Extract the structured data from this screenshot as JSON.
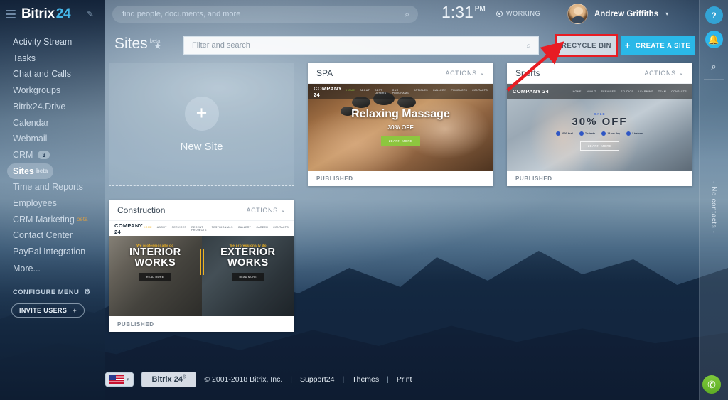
{
  "brand": {
    "name": "Bitrix",
    "number": "24",
    "hamburger_icon": "hamburger-icon",
    "edit_icon": "pencil-icon"
  },
  "topbar": {
    "search_placeholder": "find people, documents, and more",
    "search_icon": "search-icon",
    "time": "1:31",
    "ampm": "PM",
    "status": "WORKING",
    "status_icon": "record-dot-icon",
    "user_name": "Andrew Griffiths",
    "user_caret": "▾"
  },
  "sidebar": {
    "items": [
      {
        "label": "Activity Stream"
      },
      {
        "label": "Tasks"
      },
      {
        "label": "Chat and Calls"
      },
      {
        "label": "Workgroups"
      },
      {
        "label": "Bitrix24.Drive"
      },
      {
        "label": "Calendar"
      },
      {
        "label": "Webmail"
      },
      {
        "label": "CRM",
        "badge": "3"
      },
      {
        "label": "Sites",
        "beta": "beta",
        "active": true
      },
      {
        "label": "Time and Reports"
      },
      {
        "label": "Employees"
      },
      {
        "label": "CRM Marketing",
        "beta": "beta"
      },
      {
        "label": "Contact Center"
      },
      {
        "label": "PayPal Integration"
      },
      {
        "label": "More... -"
      }
    ],
    "configure_menu": "CONFIGURE MENU",
    "configure_icon": "gear-icon",
    "invite_users": "INVITE USERS",
    "invite_plus": "+"
  },
  "toolbar": {
    "title": "Sites",
    "title_beta": "beta",
    "favorite_icon": "star-icon",
    "filter_placeholder": "Filter and search",
    "filter_icon": "search-icon",
    "recycle_bin": "RECYCLE BIN",
    "create_site": "CREATE A SITE",
    "create_plus": "+",
    "highlight_color": "#e81c23",
    "create_color": "#2ab8e8"
  },
  "new_site_card": {
    "label": "New Site",
    "plus": "+"
  },
  "cards": [
    {
      "title": "SPA",
      "actions": "ACTIONS",
      "actions_chevron": "⌄",
      "status": "PUBLISHED",
      "preview": {
        "logo": "COMPANY 24",
        "nav": [
          "HOME",
          "ABOUT",
          "BEST OFFERS",
          "OUR PROGRAMS",
          "ARTICLES",
          "GALLERY",
          "PRODUCTS",
          "CONTACTS"
        ],
        "headline": "Relaxing Massage",
        "subline": "30% OFF",
        "cta": "LEARN MORE"
      }
    },
    {
      "title": "Sports",
      "actions": "ACTIONS",
      "actions_chevron": "⌄",
      "status": "PUBLISHED",
      "preview": {
        "logo": "COMPANY 24",
        "nav": [
          "HOME",
          "ABOUT",
          "SERVICES",
          "STUDIOS",
          "LEARNING",
          "TEAM",
          "CONTACTS"
        ],
        "badge": "SALE",
        "headline": "30% OFF",
        "stats": [
          "2100 kcal",
          "7 clients",
          "15 per day",
          "3 trainers"
        ],
        "cta": "LEARN MORE"
      }
    },
    {
      "title": "Construction",
      "actions": "ACTIONS",
      "actions_chevron": "⌄",
      "status": "PUBLISHED",
      "preview": {
        "logo": "COMPANY 24",
        "nav": [
          "HOME",
          "ABOUT",
          "SERVICES",
          "RECENT PROJECTS",
          "TESTIMONIALS",
          "GALLERY",
          "CAREER",
          "CONTACTS"
        ],
        "left_pre": "We professionally do",
        "left_line1": "INTERIOR",
        "left_line2": "WORKS",
        "left_btn": "READ MORE",
        "right_pre": "We professionally do",
        "right_line1": "EXTERIOR",
        "right_line2": "WORKS",
        "right_btn": "READ MORE"
      }
    }
  ],
  "rail": {
    "help_icon": "question-mark-icon",
    "help_label": "?",
    "bell_icon": "bell-icon",
    "bell_label": "🔔",
    "search_icon": "search-icon",
    "search_label": "⌕",
    "no_contacts": "- No contacts -",
    "phone_icon": "phone-icon",
    "phone_label": "✆"
  },
  "footer": {
    "flag_icon": "us-flag-icon",
    "flag_caret": "▾",
    "badge": "Bitrix 24",
    "badge_sup": "®",
    "copyright": "© 2001-2018 Bitrix, Inc.",
    "links": [
      "Support24",
      "Themes",
      "Print"
    ],
    "separator": "|"
  }
}
